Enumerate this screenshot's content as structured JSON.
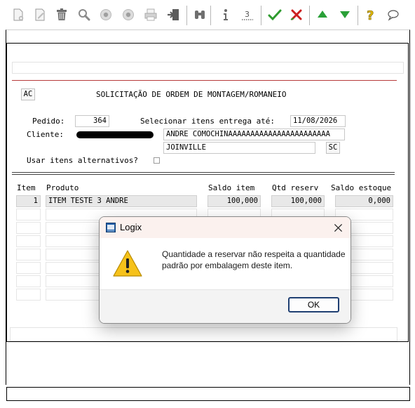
{
  "toolbar": {
    "icons": [
      "new-icon",
      "edit-icon",
      "delete-icon",
      "search-icon",
      "previous-icon",
      "next-icon",
      "print-icon",
      "exit-icon",
      "find-icon",
      "info-icon",
      "reports-icon",
      "confirm-icon",
      "cancel-icon",
      "up-icon",
      "down-icon",
      "help-icon",
      "chat-icon"
    ],
    "colors": {
      "confirm": "#2e9b2e",
      "cancel": "#cc1f1f",
      "arrows": "#2aa038",
      "help": "#e0b800"
    }
  },
  "form": {
    "mode_label": "AC",
    "title": "SOLICITAÇÃO DE ORDEM DE MONTAGEM/ROMANEIO",
    "pedido_label": "Pedido:",
    "pedido_value": "364",
    "entrega_label": "Selecionar itens entrega até:",
    "entrega_value": "11/08/2026",
    "cliente_label": "Cliente:",
    "cliente_name": "ANDRE COMOCHINAAAAAAAAAAAAAAAAAAAAAAA",
    "cidade": "JOINVILLE",
    "uf": "SC",
    "alternativos_label": "Usar itens alternativos?",
    "alternativos_checked": false,
    "separator": "=============================================================================="
  },
  "grid": {
    "headers": {
      "item": "Item",
      "produto": "Produto",
      "saldo_item": "Saldo item",
      "qtd_reserv": "Qtd reserv",
      "saldo_estoque": "Saldo estoque"
    },
    "rows": [
      {
        "item": "1",
        "produto": "ITEM TESTE 3 ANDRE",
        "saldo_item": "100,000",
        "qtd_reserv": "100,000",
        "saldo_estoque": "0,000"
      }
    ]
  },
  "dialog": {
    "title": "Logix",
    "message": "Quantidade a reservar não respeita a quantidade padrão por embalagem deste item.",
    "ok_label": "OK"
  }
}
